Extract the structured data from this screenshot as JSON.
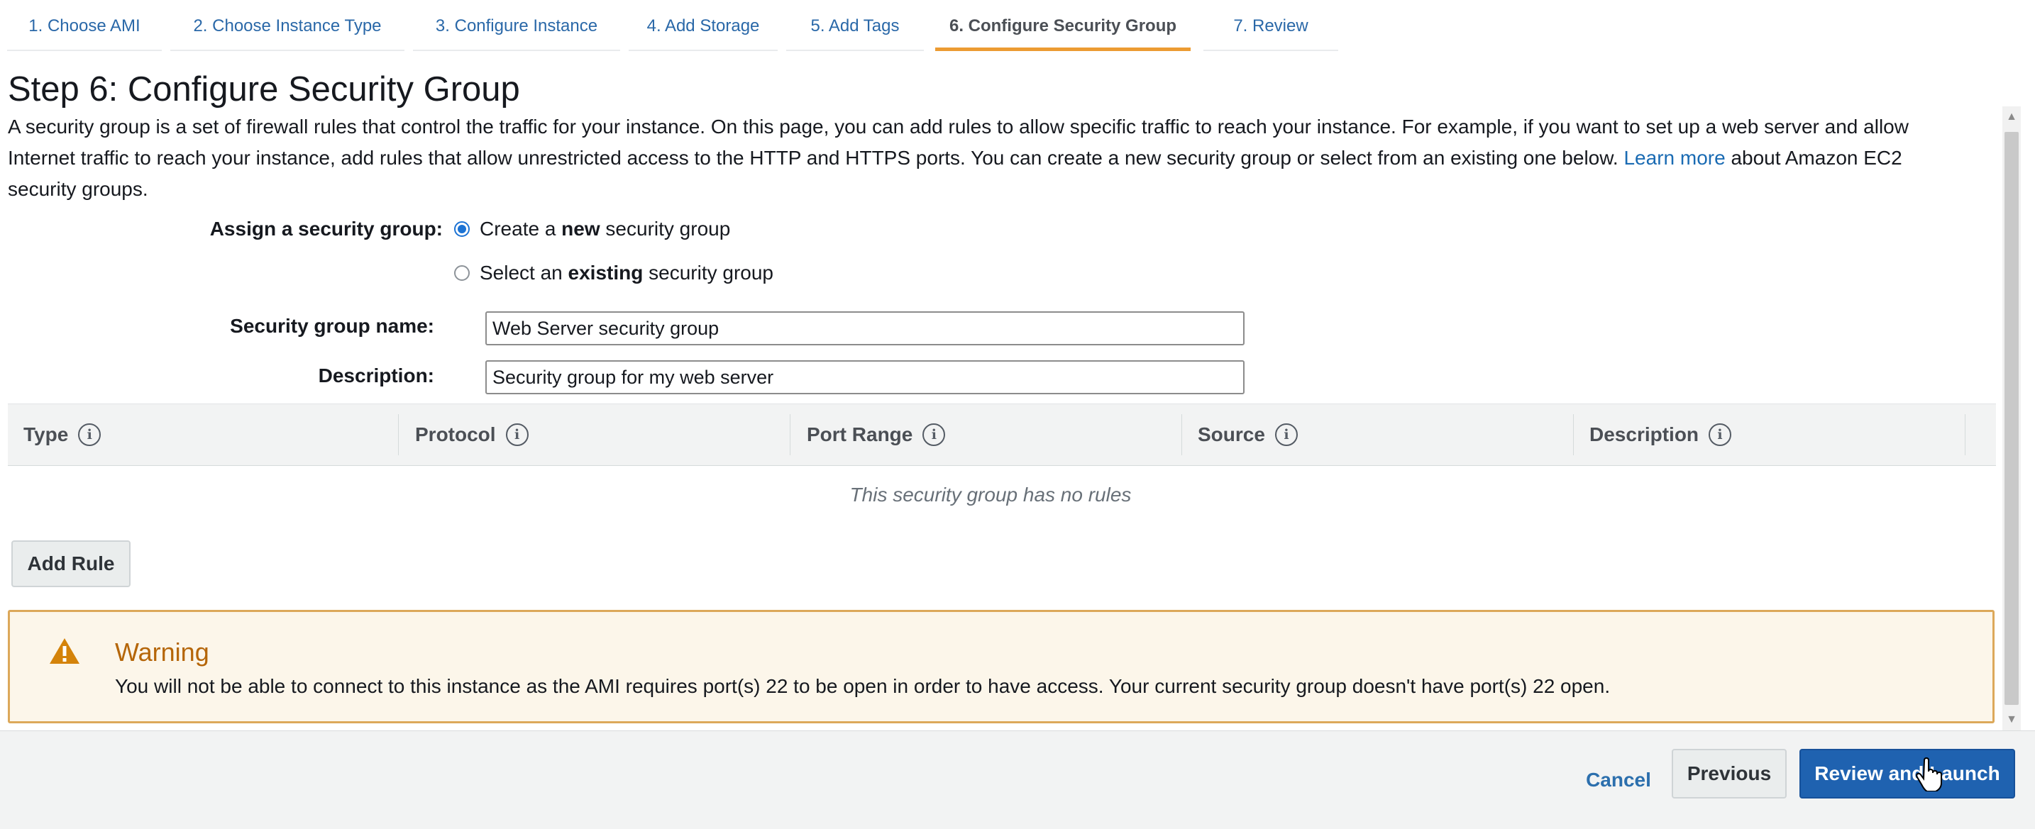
{
  "wizard": {
    "tabs": [
      {
        "label": "1. Choose AMI",
        "active": false
      },
      {
        "label": "2. Choose Instance Type",
        "active": false
      },
      {
        "label": "3. Configure Instance",
        "active": false
      },
      {
        "label": "4. Add Storage",
        "active": false
      },
      {
        "label": "5. Add Tags",
        "active": false
      },
      {
        "label": "6. Configure Security Group",
        "active": true
      },
      {
        "label": "7. Review",
        "active": false
      }
    ]
  },
  "page": {
    "title": "Step 6: Configure Security Group",
    "intro": "A security group is a set of firewall rules that control the traffic for your instance. On this page, you can add rules to allow specific traffic to reach your instance. For example, if you want to set up a web server and allow Internet traffic to reach your instance, add rules that allow unrestricted access to the HTTP and HTTPS ports. You can create a new security group or select from an existing one below.",
    "learn_more": "Learn more",
    "intro_suffix": "about Amazon EC2 security groups."
  },
  "assign": {
    "label": "Assign a security group:",
    "option_new": {
      "prefix": "Create a ",
      "bold": "new",
      "suffix": " security group",
      "checked": true
    },
    "option_existing": {
      "prefix": "Select an ",
      "bold": "existing",
      "suffix": " security group",
      "checked": false
    }
  },
  "fields": {
    "name_label": "Security group name:",
    "name_value": "Web Server security group",
    "description_label": "Description:",
    "description_value": "Security group for my web server"
  },
  "rules_table": {
    "columns": [
      "Type",
      "Protocol",
      "Port Range",
      "Source",
      "Description"
    ],
    "info_icon_glyph": "i",
    "empty_message": "This security group has no rules",
    "add_rule_label": "Add Rule"
  },
  "warning": {
    "title": "Warning",
    "message": "You will not be able to connect to this instance as the AMI requires port(s) 22 to be open in order to have access. Your current security group doesn't have port(s) 22 open.",
    "icon": "warning-triangle-icon",
    "color": "#b56609"
  },
  "footer": {
    "cancel_label": "Cancel",
    "previous_label": "Previous",
    "review_launch_label": "Review and Launch"
  },
  "colors": {
    "accent_tab": "#ec9b32",
    "link": "#2a68a8",
    "primary_button": "#1f62b0",
    "radio_checked": "#1c73d4"
  }
}
